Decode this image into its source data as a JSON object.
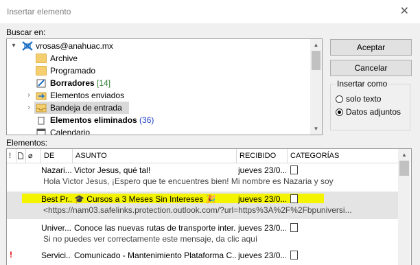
{
  "window": {
    "title": "Insertar elemento"
  },
  "labels": {
    "search_in": "Buscar en:",
    "elements": "Elementos:"
  },
  "tree": {
    "items": [
      {
        "label": "vrosas@anahuac.mx",
        "count": "",
        "bold": false,
        "icon": "mail-account-icon",
        "expander": "collapse-icon"
      },
      {
        "label": "Archive",
        "count": "",
        "bold": false,
        "icon": "folder-icon",
        "expander": ""
      },
      {
        "label": "Programado",
        "count": "",
        "bold": false,
        "icon": "folder-icon",
        "expander": ""
      },
      {
        "label": "Borradores",
        "count": "[14]",
        "bold": true,
        "icon": "drafts-icon",
        "expander": ""
      },
      {
        "label": "Elementos enviados",
        "count": "",
        "bold": false,
        "icon": "sent-items-icon",
        "expander": "expand-icon"
      },
      {
        "label": "Bandeja de entrada",
        "count": "",
        "bold": false,
        "icon": "inbox-icon",
        "expander": "expand-icon"
      },
      {
        "label": "Elementos eliminados",
        "count": "(36)",
        "bold": true,
        "icon": "trash-icon",
        "expander": ""
      },
      {
        "label": "Calendario",
        "count": "",
        "bold": false,
        "icon": "calendar-icon",
        "expander": ""
      }
    ]
  },
  "buttons": {
    "accept": "Aceptar",
    "cancel": "Cancelar"
  },
  "insert_as": {
    "title": "Insertar como",
    "options": [
      {
        "label": "solo texto",
        "selected": false
      },
      {
        "label": "Datos adjuntos",
        "selected": true
      }
    ]
  },
  "table": {
    "columns": [
      "DE",
      "ASUNTO",
      "RECIBIDO",
      "CATEGORÍAS"
    ],
    "rows": [
      {
        "from": "Nazari...",
        "subject": "Victor Jesus, qué tal!",
        "received": "jueves 23/0...",
        "preview": "Hola Victor Jesus,  ¡Espero que te encuentres bien!  Mi nombre es Nazaria y soy",
        "selected": false,
        "important": false
      },
      {
        "from": "Best Pr...",
        "subject": "🎓 Cursos a 3 Meses Sin Intereses 🎉",
        "received": "jueves 23/0...",
        "preview": "<https://nam03.safelinks.protection.outlook.com/?url=https%3A%2F%2Fbpuniversi...",
        "selected": true,
        "important": false
      },
      {
        "from": "Univer...",
        "subject": "Conoce las nuevas rutas de transporte inter...",
        "received": "jueves 23/0...",
        "preview": "Si no puedes ver correctamente este mensaje, da clic aquí",
        "selected": false,
        "important": false
      },
      {
        "from": "Servici...",
        "subject": "Comunicado - Mantenimiento Plataforma C...",
        "received": "jueves 23/0...",
        "preview": "",
        "selected": false,
        "important": true
      }
    ]
  },
  "colors": {
    "highlight": "#f4f400",
    "selection": "#d9d9d9",
    "count_green": "#2e7d32",
    "count_blue": "#1a3cc4"
  }
}
